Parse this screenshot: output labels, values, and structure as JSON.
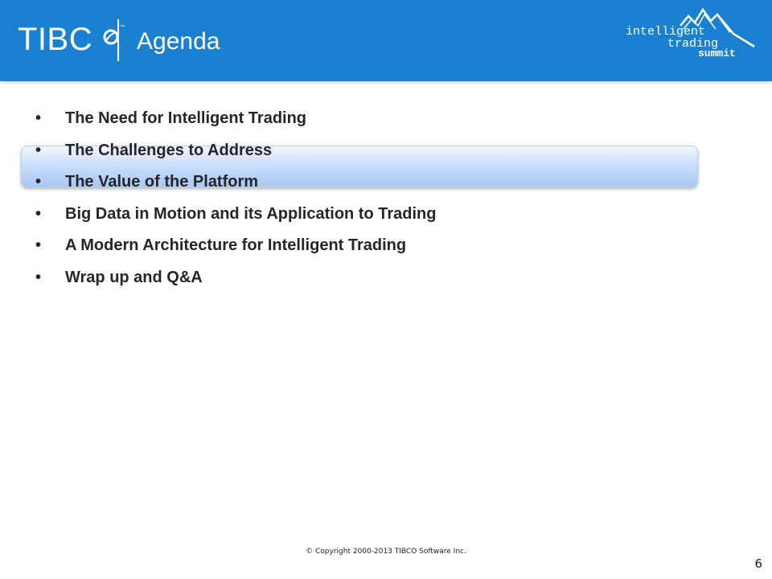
{
  "header": {
    "logo_text": "TIBC",
    "logo_tm": "™",
    "title": "Agenda",
    "badge": {
      "line1": "intelligent",
      "line2": "trading",
      "line3": "summit",
      "icon": "mountain-peaks-icon"
    },
    "background_color": "#1a80d0"
  },
  "agenda": {
    "bullet": "•",
    "highlighted_items": [
      1,
      2
    ],
    "items": [
      {
        "label": "The Need for Intelligent Trading"
      },
      {
        "label": "The Challenges to Address"
      },
      {
        "label": "The Value of the Platform"
      },
      {
        "label": "Big Data in Motion and its Application to Trading"
      },
      {
        "label": "A Modern Architecture for Intelligent Trading"
      },
      {
        "label": "Wrap up and Q&A"
      }
    ]
  },
  "footer": {
    "copyright": "© Copyright 2000-2013 TIBCO Software Inc.",
    "page_number": "6"
  }
}
